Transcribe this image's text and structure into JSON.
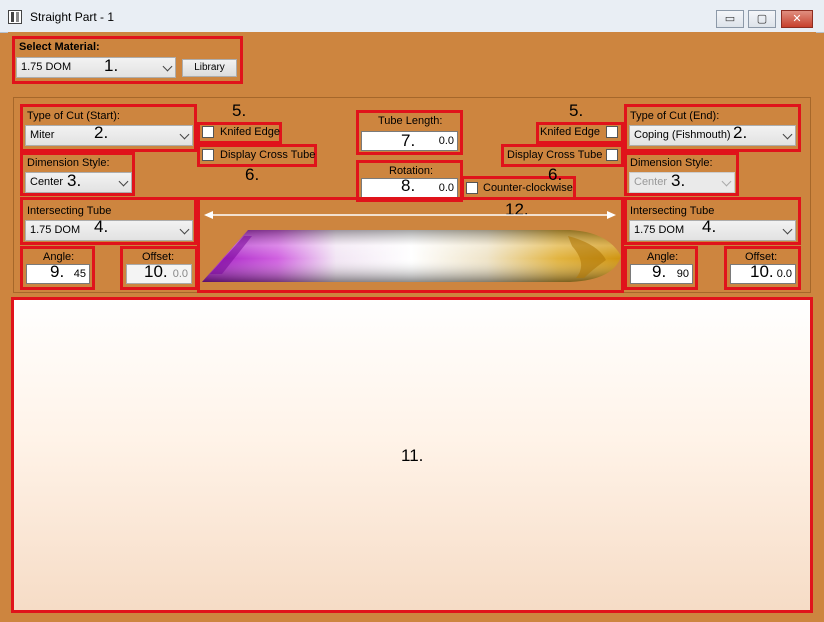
{
  "window": {
    "title": "Straight Part - 1",
    "controls": {
      "minimize": "▭",
      "maximize": "▢",
      "close": "✕"
    }
  },
  "material": {
    "label": "Select Material:",
    "value": "1.75 DOM",
    "library_button": "Library",
    "marker": "1."
  },
  "start": {
    "cut_label": "Type of Cut (Start):",
    "cut_value": "Miter",
    "cut_marker": "2.",
    "dimension_label": "Dimension Style:",
    "dimension_value": "Center",
    "dimension_marker": "3.",
    "tube_label": "Intersecting Tube",
    "tube_value": "1.75 DOM",
    "tube_marker": "4.",
    "angle_label": "Angle:",
    "angle_value": "45",
    "angle_marker": "9.",
    "offset_label": "Offset:",
    "offset_value": "0.0",
    "offset_marker": "10.",
    "knifed_label": "Knifed Edge",
    "knifed_marker": "5.",
    "cross_label": "Display Cross Tube",
    "cross_marker": "6."
  },
  "center": {
    "length_label": "Tube Length:",
    "length_value": "0.0",
    "length_marker": "7.",
    "rotation_label": "Rotation:",
    "rotation_value": "0.0",
    "rotation_marker": "8.",
    "ccw_label": "Counter-clockwise",
    "dim_marker": "12."
  },
  "end": {
    "cut_label": "Type of Cut (End):",
    "cut_value": "Coping (Fishmouth)",
    "cut_marker": "2.",
    "dimension_label": "Dimension Style:",
    "dimension_value": "Center",
    "dimension_marker": "3.",
    "tube_label": "Intersecting Tube",
    "tube_value": "1.75 DOM",
    "tube_marker": "4.",
    "angle_label": "Angle:",
    "angle_value": "90",
    "angle_marker": "9.",
    "offset_label": "Offset:",
    "offset_value": "0.0",
    "offset_marker": "10.",
    "knifed_label": "Knifed Edge",
    "knifed_marker": "5.",
    "cross_label": "Display Cross Tube",
    "cross_marker": "6."
  },
  "preview": {
    "marker": "11."
  },
  "colors": {
    "background": "#cd853f",
    "highlight": "#e0131b",
    "tube_start": "#b020c8",
    "tube_end": "#e0a818"
  }
}
